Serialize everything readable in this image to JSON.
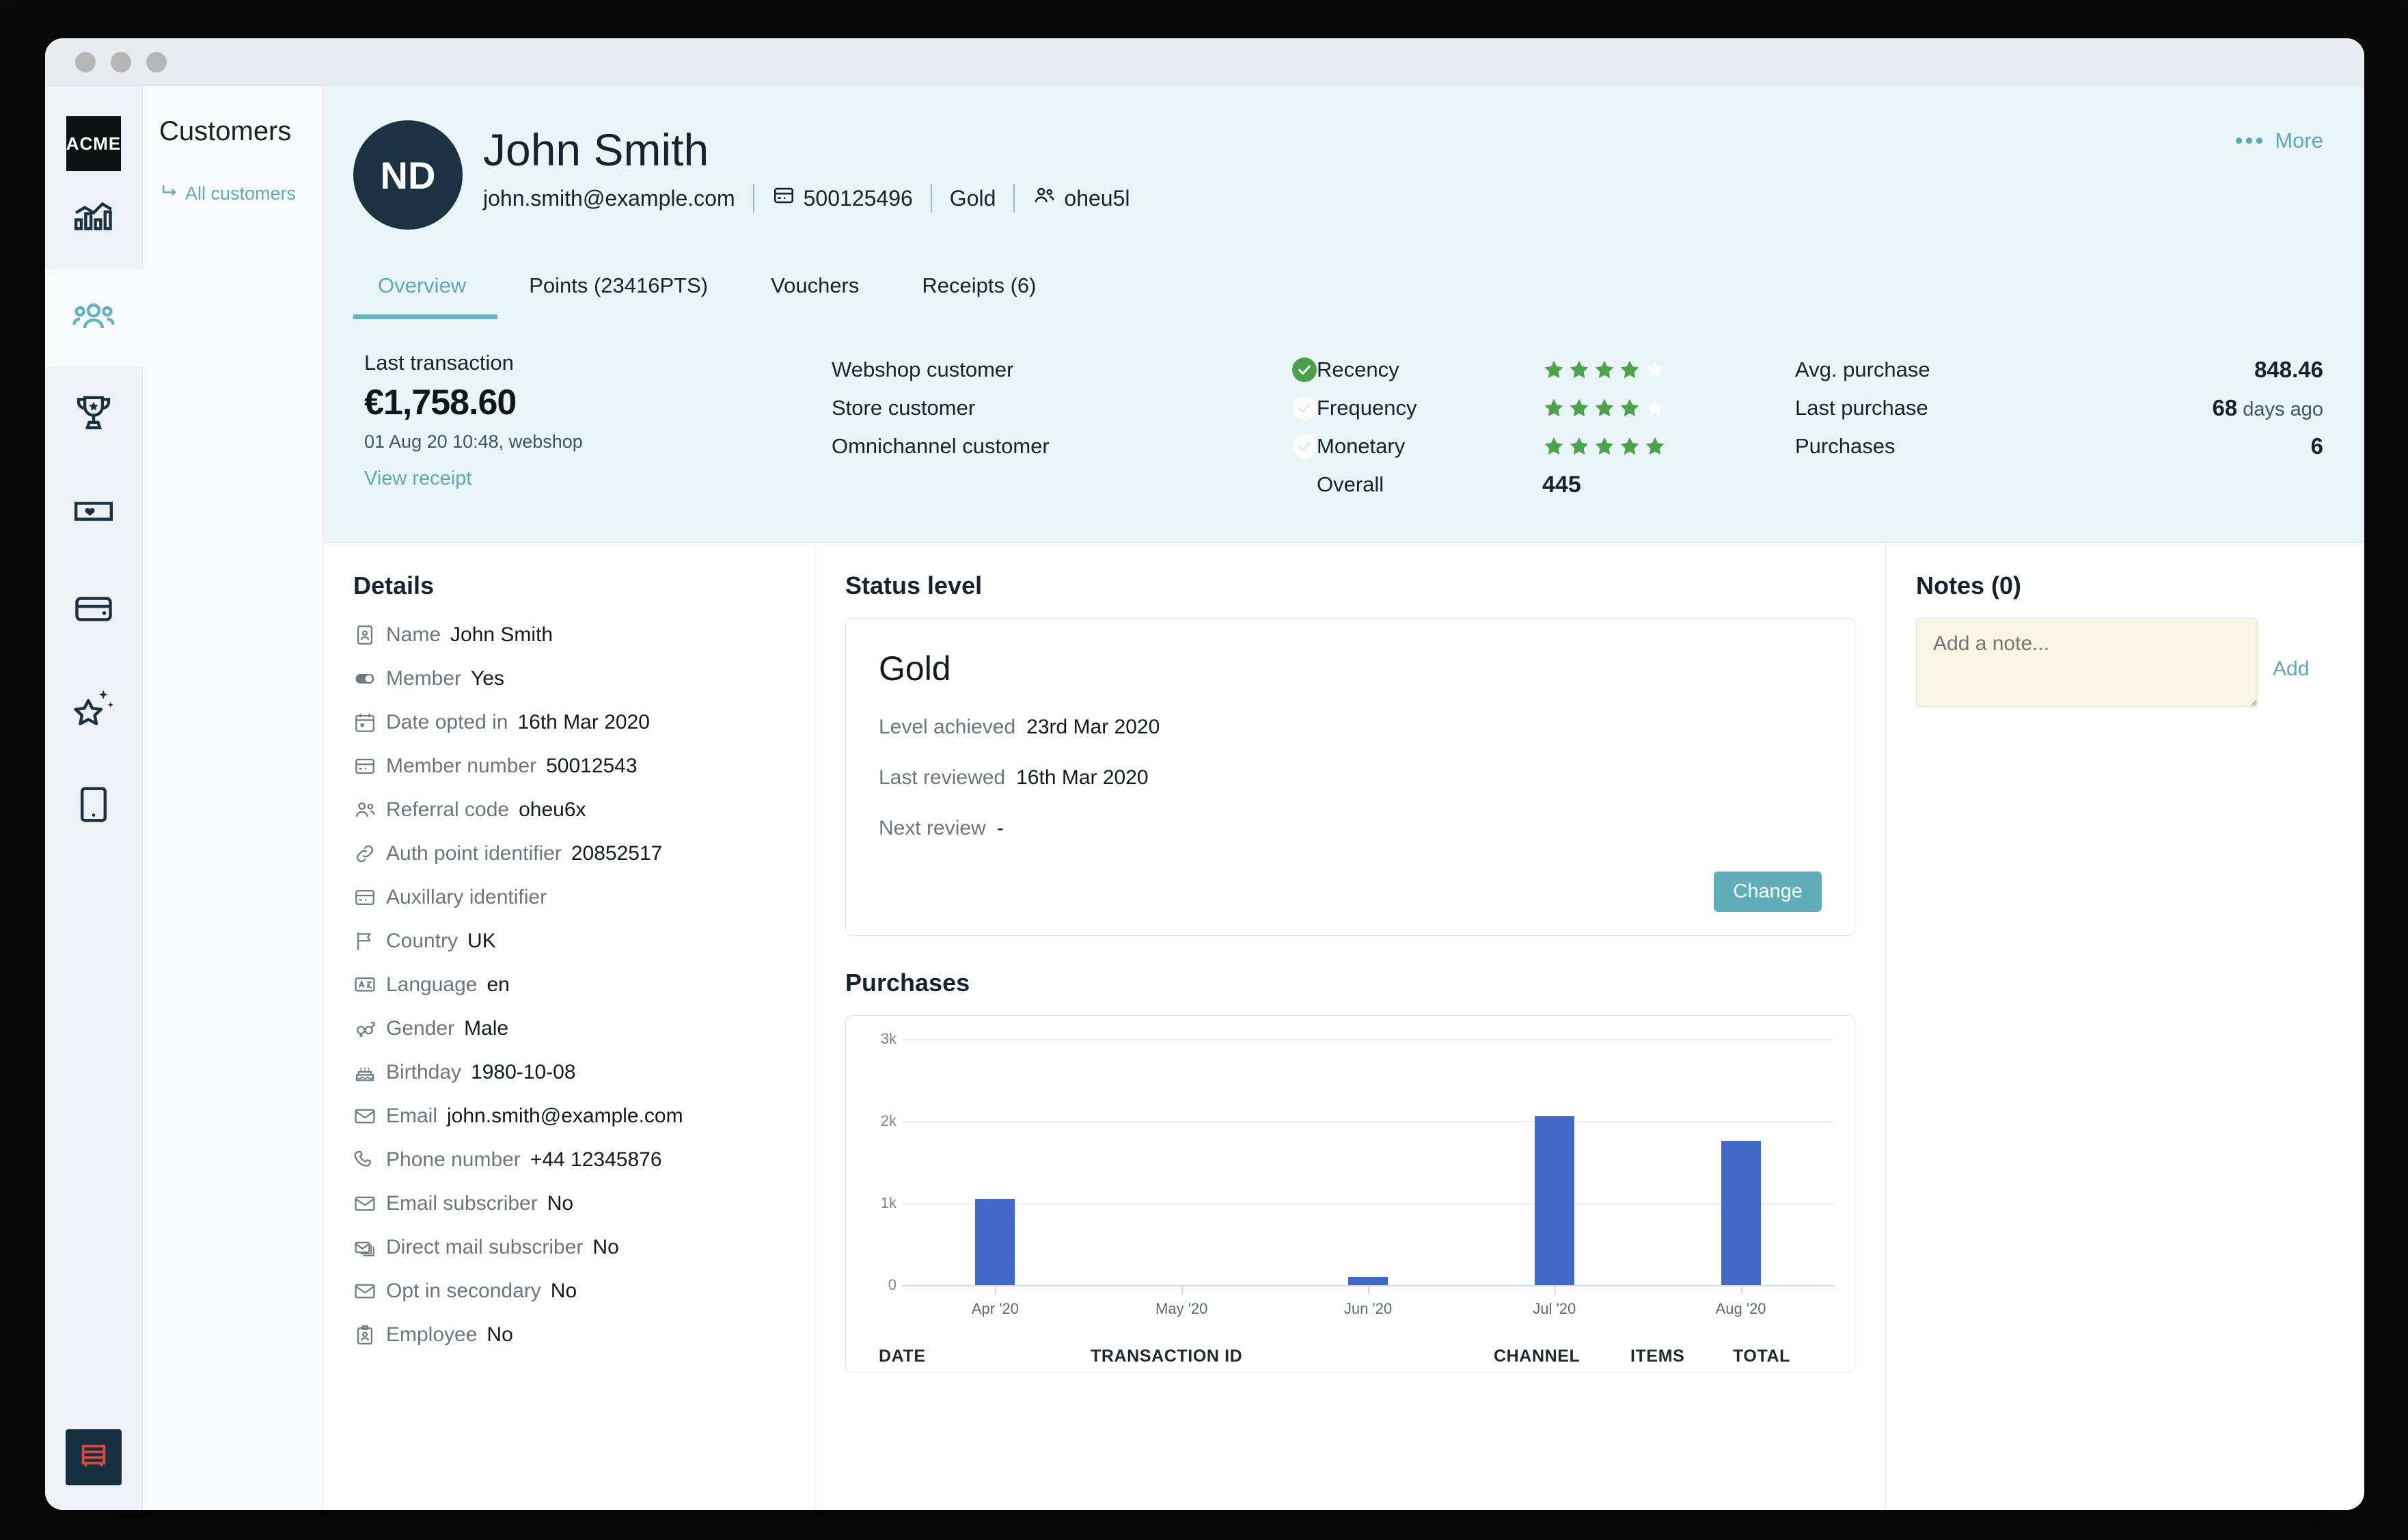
{
  "window": {
    "dots": 3
  },
  "rail": {
    "logo": "ACME",
    "items": [
      {
        "name": "analytics",
        "icon": "chart-icon",
        "active": false
      },
      {
        "name": "customers",
        "icon": "people-icon",
        "active": true
      },
      {
        "name": "rewards",
        "icon": "trophy-icon",
        "active": false
      },
      {
        "name": "vouchers",
        "icon": "voucher-heart-icon",
        "active": false
      },
      {
        "name": "wallet",
        "icon": "wallet-icon",
        "active": false
      },
      {
        "name": "campaigns",
        "icon": "sparkle-star-icon",
        "active": false
      },
      {
        "name": "mobile",
        "icon": "mobile-icon",
        "active": false
      }
    ],
    "bottom_tile_icon": "bookshelf-icon"
  },
  "subnav": {
    "title": "Customers",
    "breadcrumb": "All customers",
    "breadcrumb_icon": "arrow-return-icon"
  },
  "header": {
    "avatar_initials": "ND",
    "name": "John Smith",
    "email": "john.smith@example.com",
    "member_number": "500125496",
    "member_number_icon": "card-icon",
    "level": "Gold",
    "referral": "oheu5l",
    "referral_icon": "people-icon",
    "more_label": "More",
    "more_icon": "ellipsis-icon"
  },
  "tabs": [
    {
      "label": "Overview",
      "active": true
    },
    {
      "label": "Points (23416PTS)",
      "active": false
    },
    {
      "label": "Vouchers",
      "active": false
    },
    {
      "label": "Receipts (6)",
      "active": false
    }
  ],
  "stats": {
    "last_transaction": {
      "label": "Last transaction",
      "amount": "€1,758.60",
      "meta": "01 Aug 20 10:48, webshop",
      "link": "View receipt"
    },
    "channels": [
      {
        "label": "Webshop customer",
        "checked": true
      },
      {
        "label": "Store customer",
        "checked": false
      },
      {
        "label": "Omnichannel customer",
        "checked": false
      }
    ],
    "rfm": [
      {
        "label": "Recency",
        "stars": 4
      },
      {
        "label": "Frequency",
        "stars": 4
      },
      {
        "label": "Monetary",
        "stars": 5
      }
    ],
    "overall": {
      "label": "Overall",
      "value": "445"
    },
    "purchases": [
      {
        "label": "Avg. purchase",
        "value": "848.46",
        "unit": ""
      },
      {
        "label": "Last purchase",
        "value": "68",
        "unit": " days ago"
      },
      {
        "label": "Purchases",
        "value": "6",
        "unit": ""
      }
    ]
  },
  "details": {
    "title": "Details",
    "rows": [
      {
        "icon": "id-card-icon",
        "key": "Name",
        "value": "John Smith"
      },
      {
        "icon": "toggle-icon",
        "key": "Member",
        "value": "Yes"
      },
      {
        "icon": "calendar-icon",
        "key": "Date opted in",
        "value": "16th Mar 2020"
      },
      {
        "icon": "card-icon",
        "key": "Member number",
        "value": "50012543"
      },
      {
        "icon": "people-icon",
        "key": "Referral code",
        "value": "oheu6x"
      },
      {
        "icon": "link-icon",
        "key": "Auth point identifier",
        "value": "20852517"
      },
      {
        "icon": "card-icon",
        "key": "Auxillary identifier",
        "value": ""
      },
      {
        "icon": "flag-icon",
        "key": "Country",
        "value": "UK"
      },
      {
        "icon": "translate-icon",
        "key": "Language",
        "value": "en"
      },
      {
        "icon": "gender-icon",
        "key": "Gender",
        "value": "Male"
      },
      {
        "icon": "cake-icon",
        "key": "Birthday",
        "value": "1980-10-08"
      },
      {
        "icon": "envelope-icon",
        "key": "Email",
        "value": "john.smith@example.com"
      },
      {
        "icon": "phone-icon",
        "key": "Phone number",
        "value": "+44 12345876"
      },
      {
        "icon": "envelope-icon",
        "key": "Email subscriber",
        "value": "No"
      },
      {
        "icon": "mail-stack-icon",
        "key": "Direct mail subscriber",
        "value": "No"
      },
      {
        "icon": "envelope-icon",
        "key": "Opt in secondary",
        "value": "No"
      },
      {
        "icon": "badge-icon",
        "key": "Employee",
        "value": "No"
      }
    ]
  },
  "status_level": {
    "title": "Status level",
    "level": "Gold",
    "rows": [
      {
        "key": "Level achieved",
        "value": "23rd Mar 2020"
      },
      {
        "key": "Last reviewed",
        "value": "16th Mar 2020"
      },
      {
        "key": "Next review",
        "value": "-"
      }
    ],
    "change_label": "Change"
  },
  "purchases_section": {
    "title": "Purchases",
    "table_headers": [
      "DATE",
      "TRANSACTION ID",
      "CHANNEL",
      "ITEMS",
      "TOTAL"
    ]
  },
  "notes": {
    "title": "Notes (0)",
    "placeholder": "Add a note...",
    "value": "",
    "add_label": "Add"
  },
  "colors": {
    "accent_teal": "#5fa9b5",
    "dark_navy": "#16232e",
    "bar_blue": "#4069c8",
    "check_green": "#48a14a",
    "star_green": "#4ea24e",
    "note_cream": "#faf6e3"
  },
  "chart_data": {
    "type": "bar",
    "title": "Purchases",
    "categories": [
      "Apr '20",
      "May '20",
      "Jun '20",
      "Jul '20",
      "Aug '20"
    ],
    "values": [
      1050,
      0,
      100,
      2060,
      1760
    ],
    "xlabel": "",
    "ylabel": "",
    "ylim": [
      0,
      3000
    ],
    "yticks": [
      0,
      1000,
      2000,
      3000
    ],
    "ytick_labels": [
      "0",
      "1k",
      "2k",
      "3k"
    ],
    "grid": true,
    "legend": false
  }
}
